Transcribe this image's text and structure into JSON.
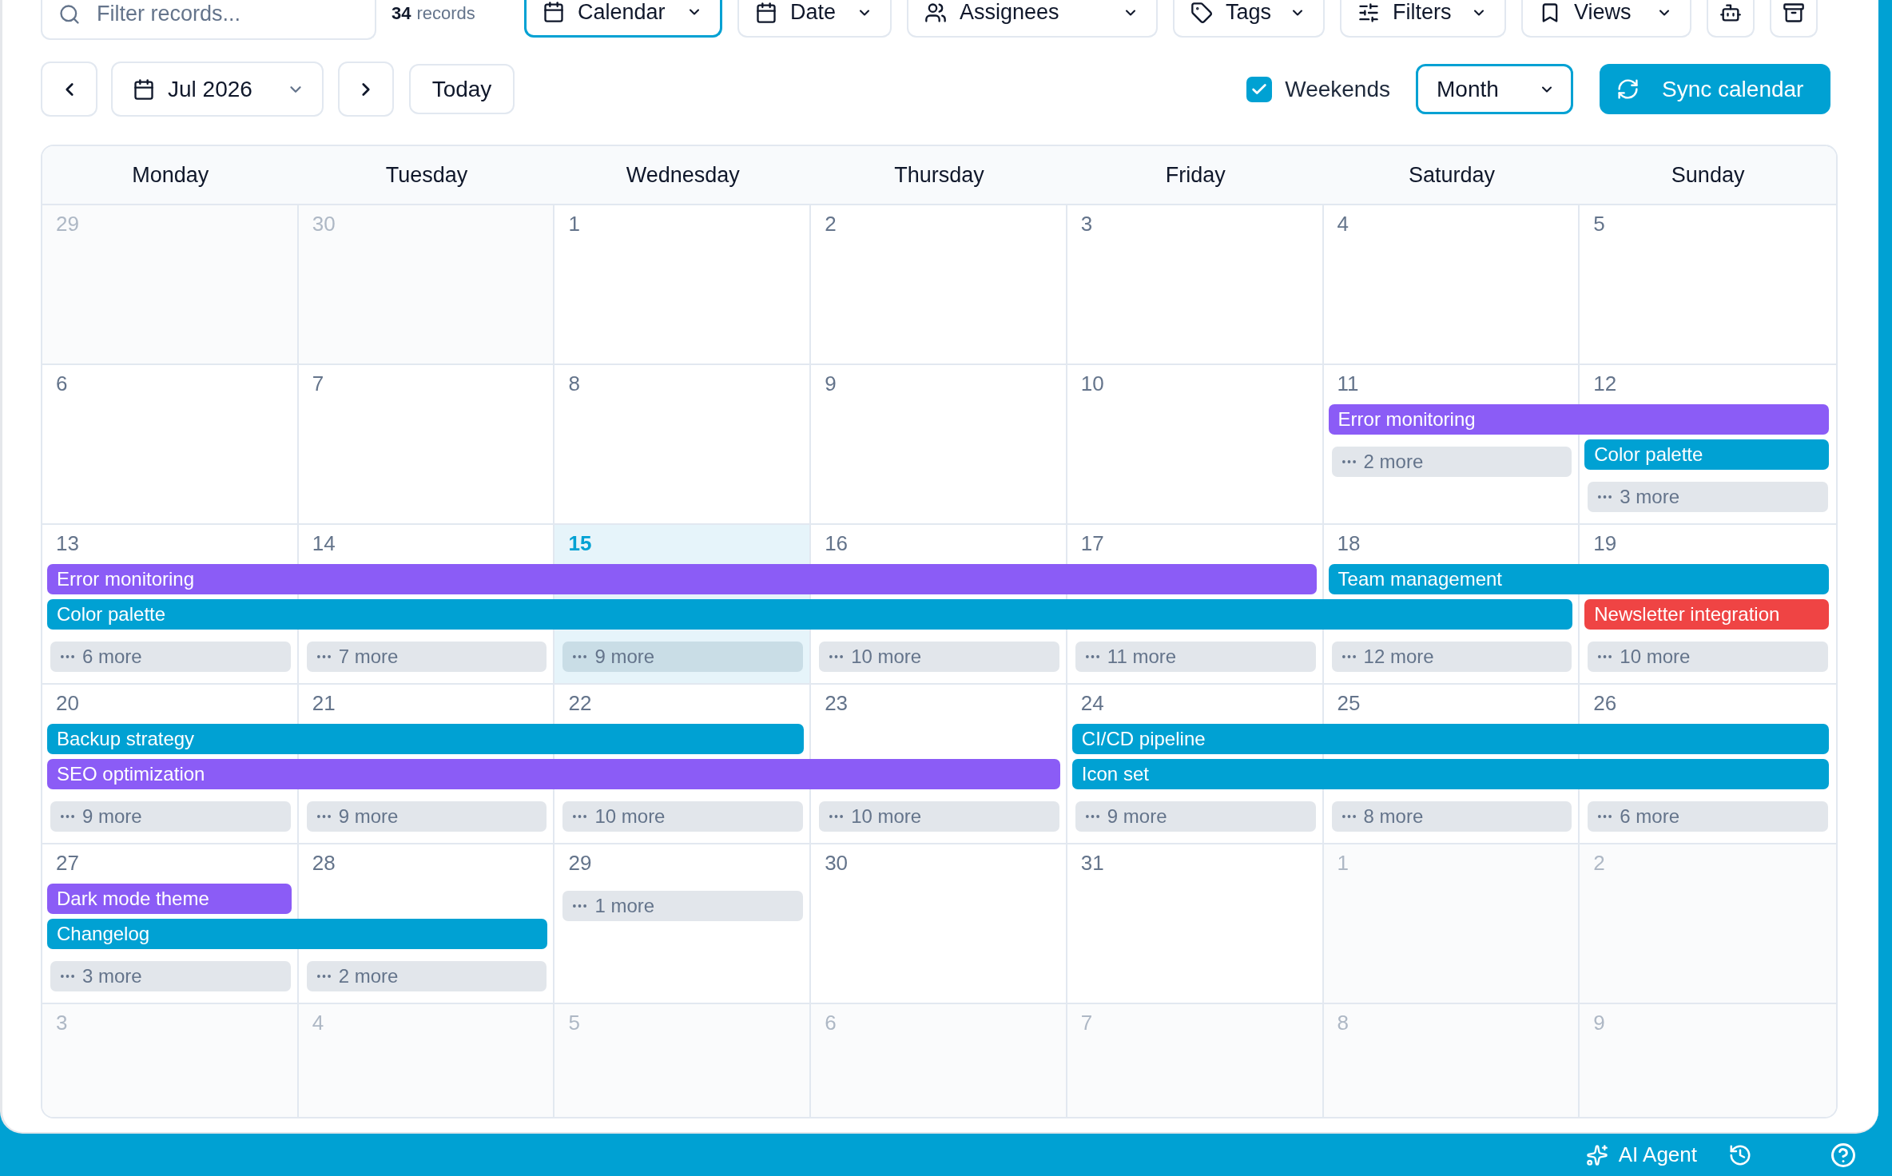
{
  "toolbar": {
    "search": {
      "placeholder": "Filter records..."
    },
    "record_count": {
      "count": "34",
      "label": "records"
    },
    "view_buttons": [
      {
        "label": "Calendar",
        "selected": true
      },
      {
        "label": "Date",
        "selected": false
      },
      {
        "label": "Assignees",
        "selected": false
      },
      {
        "label": "Tags",
        "selected": false
      },
      {
        "label": "Filters",
        "selected": false
      },
      {
        "label": "Views",
        "selected": false
      }
    ]
  },
  "navigation": {
    "month_picker": {
      "value": "Jul 2026"
    },
    "today_button": {
      "label": "Today"
    },
    "weekends": {
      "label": "Weekends",
      "checked": true
    },
    "view_select": {
      "value": "Month"
    },
    "sync_button": {
      "label": "Sync calendar"
    }
  },
  "calendar": {
    "weekdays": [
      "Monday",
      "Tuesday",
      "Wednesday",
      "Thursday",
      "Friday",
      "Saturday",
      "Sunday"
    ],
    "weeks": [
      {
        "days": [
          {
            "date": "29",
            "in_month": false,
            "today": false
          },
          {
            "date": "30",
            "in_month": false,
            "today": false
          },
          {
            "date": "1",
            "in_month": true,
            "today": false
          },
          {
            "date": "2",
            "in_month": true,
            "today": false
          },
          {
            "date": "3",
            "in_month": true,
            "today": false
          },
          {
            "date": "4",
            "in_month": true,
            "today": false
          },
          {
            "date": "5",
            "in_month": true,
            "today": false
          }
        ]
      },
      {
        "days": [
          {
            "date": "6",
            "in_month": true,
            "today": false
          },
          {
            "date": "7",
            "in_month": true,
            "today": false
          },
          {
            "date": "8",
            "in_month": true,
            "today": false
          },
          {
            "date": "9",
            "in_month": true,
            "today": false
          },
          {
            "date": "10",
            "in_month": true,
            "today": false
          },
          {
            "date": "11",
            "in_month": true,
            "today": false,
            "slots": [
              {
                "kind": "event",
                "title": "Error monitoring",
                "color": "#8b5cf6"
              },
              {
                "kind": "more",
                "label": "2 more"
              }
            ]
          },
          {
            "date": "12",
            "in_month": true,
            "today": false,
            "slots": [
              {
                "kind": "continued"
              },
              {
                "kind": "event",
                "title": "Color palette",
                "color": "#00a1d3"
              },
              {
                "kind": "more",
                "label": "3 more"
              }
            ]
          }
        ]
      },
      {
        "days": [
          {
            "date": "13",
            "in_month": true,
            "today": false,
            "slots": [
              {
                "kind": "event",
                "title": "Error monitoring",
                "color": "#8b5cf6"
              },
              {
                "kind": "event",
                "title": "Color palette",
                "color": "#00a1d3"
              },
              {
                "kind": "more",
                "label": "6 more"
              }
            ]
          },
          {
            "date": "14",
            "in_month": true,
            "today": false,
            "slots": [
              {
                "kind": "continued"
              },
              {
                "kind": "continued"
              },
              {
                "kind": "more",
                "label": "7 more"
              }
            ]
          },
          {
            "date": "15",
            "in_month": true,
            "today": true,
            "slots": [
              {
                "kind": "continued"
              },
              {
                "kind": "continued"
              },
              {
                "kind": "more",
                "label": "9 more"
              }
            ]
          },
          {
            "date": "16",
            "in_month": true,
            "today": false,
            "slots": [
              {
                "kind": "continued"
              },
              {
                "kind": "continued"
              },
              {
                "kind": "more",
                "label": "10 more"
              }
            ]
          },
          {
            "date": "17",
            "in_month": true,
            "today": false,
            "slots": [
              {
                "kind": "continued"
              },
              {
                "kind": "continued"
              },
              {
                "kind": "more",
                "label": "11 more"
              }
            ]
          },
          {
            "date": "18",
            "in_month": true,
            "today": false,
            "slots": [
              {
                "kind": "event",
                "title": "Team management",
                "color": "#00a1d3"
              },
              {
                "kind": "continued"
              },
              {
                "kind": "more",
                "label": "12 more"
              }
            ]
          },
          {
            "date": "19",
            "in_month": true,
            "today": false,
            "slots": [
              {
                "kind": "continued"
              },
              {
                "kind": "event",
                "title": "Newsletter integration",
                "color": "#ef4444"
              },
              {
                "kind": "more",
                "label": "10 more"
              }
            ]
          }
        ]
      },
      {
        "days": [
          {
            "date": "20",
            "in_month": true,
            "today": false,
            "slots": [
              {
                "kind": "event",
                "title": "Backup strategy",
                "color": "#00a1d3"
              },
              {
                "kind": "event",
                "title": "SEO optimization",
                "color": "#8b5cf6"
              },
              {
                "kind": "more",
                "label": "9 more"
              }
            ]
          },
          {
            "date": "21",
            "in_month": true,
            "today": false,
            "slots": [
              {
                "kind": "continued"
              },
              {
                "kind": "continued"
              },
              {
                "kind": "more",
                "label": "9 more"
              }
            ]
          },
          {
            "date": "22",
            "in_month": true,
            "today": false,
            "slots": [
              {
                "kind": "continued"
              },
              {
                "kind": "continued"
              },
              {
                "kind": "more",
                "label": "10 more"
              }
            ]
          },
          {
            "date": "23",
            "in_month": true,
            "today": false,
            "slots": [
              {
                "kind": "empty"
              },
              {
                "kind": "continued"
              },
              {
                "kind": "more",
                "label": "10 more"
              }
            ]
          },
          {
            "date": "24",
            "in_month": true,
            "today": false,
            "slots": [
              {
                "kind": "event",
                "title": "CI/CD pipeline",
                "color": "#00a1d3"
              },
              {
                "kind": "event",
                "title": "Icon set",
                "color": "#00a1d3"
              },
              {
                "kind": "more",
                "label": "9 more"
              }
            ]
          },
          {
            "date": "25",
            "in_month": true,
            "today": false,
            "slots": [
              {
                "kind": "continued"
              },
              {
                "kind": "continued"
              },
              {
                "kind": "more",
                "label": "8 more"
              }
            ]
          },
          {
            "date": "26",
            "in_month": true,
            "today": false,
            "slots": [
              {
                "kind": "continued"
              },
              {
                "kind": "continued"
              },
              {
                "kind": "more",
                "label": "6 more"
              }
            ]
          }
        ]
      },
      {
        "days": [
          {
            "date": "27",
            "in_month": true,
            "today": false,
            "slots": [
              {
                "kind": "event",
                "title": "Dark mode theme",
                "color": "#8b5cf6"
              },
              {
                "kind": "event",
                "title": "Changelog",
                "color": "#00a1d3"
              },
              {
                "kind": "more",
                "label": "3 more"
              }
            ]
          },
          {
            "date": "28",
            "in_month": true,
            "today": false,
            "slots": [
              {
                "kind": "empty"
              },
              {
                "kind": "continued"
              },
              {
                "kind": "more",
                "label": "2 more"
              }
            ]
          },
          {
            "date": "29",
            "in_month": true,
            "today": false,
            "slots": [
              {
                "kind": "more",
                "label": "1 more"
              }
            ]
          },
          {
            "date": "30",
            "in_month": true,
            "today": false
          },
          {
            "date": "31",
            "in_month": true,
            "today": false
          },
          {
            "date": "1",
            "in_month": false,
            "today": false
          },
          {
            "date": "2",
            "in_month": false,
            "today": false
          }
        ]
      },
      {
        "days": [
          {
            "date": "3",
            "in_month": false,
            "today": false
          },
          {
            "date": "4",
            "in_month": false,
            "today": false
          },
          {
            "date": "5",
            "in_month": false,
            "today": false
          },
          {
            "date": "6",
            "in_month": false,
            "today": false
          },
          {
            "date": "7",
            "in_month": false,
            "today": false
          },
          {
            "date": "8",
            "in_month": false,
            "today": false
          },
          {
            "date": "9",
            "in_month": false,
            "today": false
          }
        ]
      }
    ]
  },
  "status_bar": {
    "ai_agent": {
      "label": "AI Agent"
    }
  }
}
